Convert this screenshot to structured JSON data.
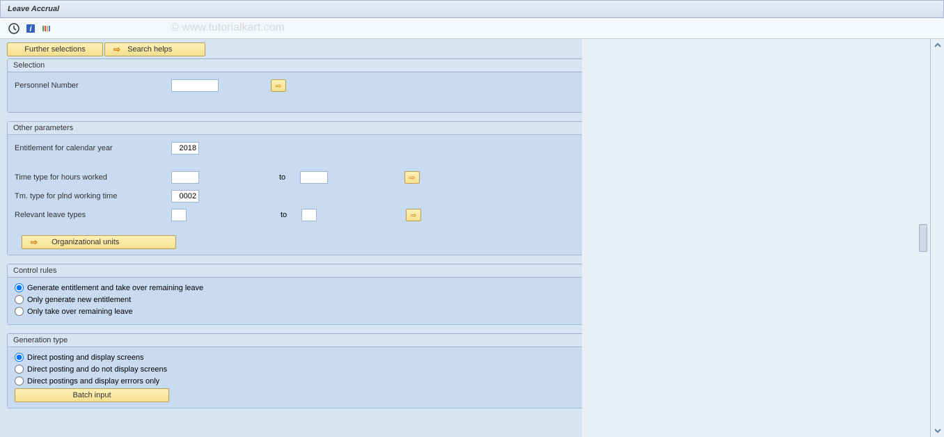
{
  "title": "Leave Accrual",
  "watermark": "© www.tutorialkart.com",
  "top_buttons": {
    "further_selections": "Further selections",
    "search_helps": "Search helps"
  },
  "selection": {
    "header": "Selection",
    "personnel_number_label": "Personnel Number",
    "personnel_number_value": ""
  },
  "other_params": {
    "header": "Other parameters",
    "entitlement_label": "Entitlement for calendar year",
    "entitlement_value": "2018",
    "time_type_hours_label": "Time type for hours worked",
    "time_type_hours_from": "",
    "time_type_hours_to": "",
    "to_label": "to",
    "tm_type_plnd_label": "Tm. type for plnd working time",
    "tm_type_plnd_value": "0002",
    "relevant_leave_label": "Relevant leave types",
    "relevant_leave_from": "",
    "relevant_leave_to": "",
    "org_units_button": "Organizational units"
  },
  "control_rules": {
    "header": "Control rules",
    "opt1": "Generate entitlement and take over remaining leave",
    "opt2": "Only generate new entitlement",
    "opt3": "Only take over remaining leave"
  },
  "generation_type": {
    "header": "Generation type",
    "opt1": "Direct posting and display screens",
    "opt2": "Direct posting and do not display screens",
    "opt3": "Direct postings and display errrors only",
    "batch_button": "Batch input"
  }
}
